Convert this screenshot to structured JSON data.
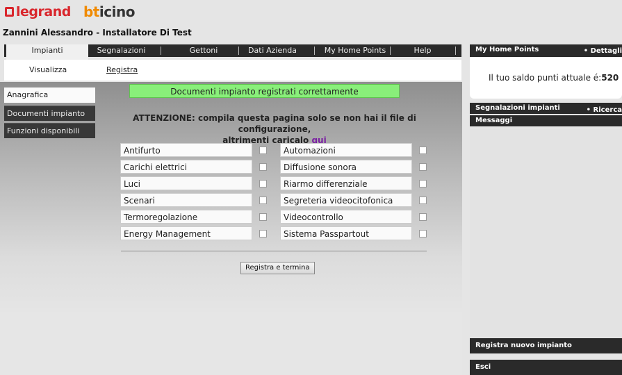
{
  "header": {
    "logo_legrand": "legrand",
    "logo_bticino_b": "bt",
    "logo_bticino_rest": "icino",
    "user_line": "Zannini Alessandro - Installatore Di Test"
  },
  "tabs": [
    "Impianti",
    "Segnalazioni",
    "Gettoni",
    "Dati Azienda",
    "My Home Points",
    "Help"
  ],
  "subnav": {
    "visualizza": "Visualizza",
    "registra": "Registra"
  },
  "side_menu": [
    "Anagrafica",
    "Documenti impianto",
    "Funzioni disponibili"
  ],
  "main": {
    "success_message": "Documenti impianto registrati correttamente",
    "warning_line1": "ATTENZIONE: compila questa pagina solo se non hai il file di configurazione,",
    "warning_line2_prefix": "altrimenti caricalo ",
    "warning_link": "qui",
    "functions_left": [
      "Antifurto",
      "Carichi elettrici",
      "Luci",
      "Scenari",
      "Termoregolazione",
      "Energy Management"
    ],
    "functions_right": [
      "Automazioni",
      "Diffusione sonora",
      "Riarmo differenziale",
      "Segreteria videocitofonica",
      "Videocontrollo",
      "Sistema Passpartout"
    ],
    "submit_label": "Registra e termina"
  },
  "right_panel": {
    "points_title": "My Home Points",
    "points_link": "• Dettagli",
    "saldo_label": "Il tuo saldo punti attuale é:",
    "saldo_value": "520",
    "segnalazioni_title": "Segnalazioni impianti",
    "segnalazioni_link": "• Ricerca",
    "messaggi_title": "Messaggi",
    "registra_title": "Registra nuovo impianto",
    "esci_title": "Esci"
  },
  "colors": {
    "success_bg": "#89ef7a",
    "dark_bar": "#2a2a2a",
    "legrand_red": "#d9262c",
    "bticino_orange": "#f08a00",
    "link_purple": "#7a1fa2"
  }
}
